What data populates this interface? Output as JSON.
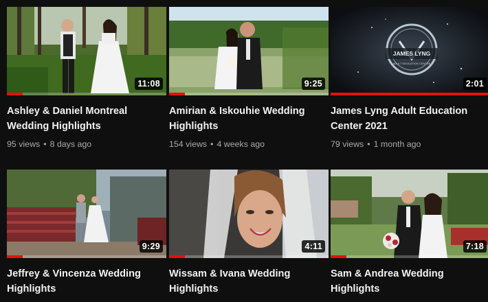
{
  "colors": {
    "background": "#0f0f0f",
    "progress": "#e3120b",
    "meta": "#aaaaaa"
  },
  "videos": [
    {
      "title": "Ashley & Daniel Montreal Wedding Highlights",
      "duration": "11:08",
      "views": "95 views",
      "age": "8 days ago",
      "watched": 0.1
    },
    {
      "title": "Amirian & Iskouhie Wedding Highlights",
      "duration": "9:25",
      "views": "154 views",
      "age": "4 weeks ago",
      "watched": 0.1
    },
    {
      "title": "James Lyng Adult Education Center 2021",
      "duration": "2:01",
      "views": "79 views",
      "age": "1 month ago",
      "watched": 1.0,
      "logo_text": "JAMES LYNG",
      "logo_subtext": "ADULT EDUCATION CENTRE"
    },
    {
      "title": "Jeffrey & Vincenza Wedding Highlights",
      "duration": "9:29",
      "watched": 0.1
    },
    {
      "title": "Wissam & Ivana Wedding Highlights",
      "duration": "4:11",
      "watched": 0.1
    },
    {
      "title": "Sam & Andrea Wedding Highlights",
      "duration": "7:18",
      "watched": 0.1
    }
  ]
}
